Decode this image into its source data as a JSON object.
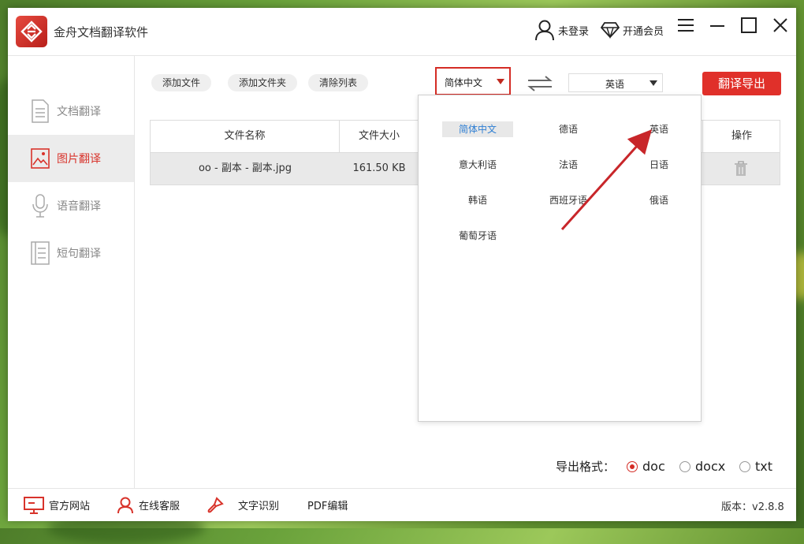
{
  "window": {
    "title": "金舟文档翻译软件",
    "login_text": "未登录",
    "vip_text": "开通会员"
  },
  "sidebar": {
    "items": [
      {
        "label": "文档翻译",
        "active": false
      },
      {
        "label": "图片翻译",
        "active": true
      },
      {
        "label": "语音翻译",
        "active": false
      },
      {
        "label": "短句翻译",
        "active": false
      }
    ]
  },
  "toolbar": {
    "add_file": "添加文件",
    "add_folder": "添加文件夹",
    "clear_list": "清除列表",
    "source_lang": "简体中文",
    "target_lang": "英语",
    "export_button": "翻译导出"
  },
  "table": {
    "headers": {
      "name": "文件名称",
      "size": "文件大小",
      "action": "操作"
    },
    "rows": [
      {
        "name": "oo - 副本 - 副本.jpg",
        "size": "161.50 KB"
      }
    ]
  },
  "dropdown": {
    "selected": "简体中文",
    "options": [
      "简体中文",
      "德语",
      "英语",
      "意大利语",
      "法语",
      "日语",
      "韩语",
      "西班牙语",
      "俄语",
      "葡萄牙语"
    ]
  },
  "export_format": {
    "label": "导出格式：",
    "options": [
      "doc",
      "docx",
      "txt"
    ],
    "selected": "doc"
  },
  "footer": {
    "website": "官方网站",
    "support": "在线客服",
    "ocr": "文字识别",
    "pdf": "PDF编辑",
    "version": "版本：v2.8.8"
  },
  "colors": {
    "accent": "#e0302a",
    "selected_text": "#2f7fd3",
    "sidebar_active_bg": "#ececec"
  }
}
